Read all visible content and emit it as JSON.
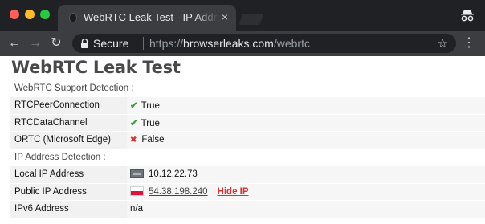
{
  "browser": {
    "tab_title": "WebRTC Leak Test - IP Address",
    "tab_close": "×",
    "secure_label": "Secure",
    "url_scheme": "https://",
    "url_host": "browserleaks.com",
    "url_path": "/webrtc",
    "icons": {
      "back": "arrow-left-icon",
      "forward": "arrow-right-icon",
      "reload": "reload-icon",
      "star": "star-icon",
      "menu": "kebab-menu-icon",
      "incognito": "incognito-icon"
    }
  },
  "page": {
    "title": "WebRTC Leak Test",
    "support_section": "WebRTC Support Detection :",
    "support_rows": [
      {
        "label": "RTCPeerConnection",
        "value": "True",
        "status": "ok"
      },
      {
        "label": "RTCDataChannel",
        "value": "True",
        "status": "ok"
      },
      {
        "label": "ORTC (Microsoft Edge)",
        "value": "False",
        "status": "no"
      }
    ],
    "ip_section": "IP Address Detection :",
    "ip_rows": {
      "local": {
        "label": "Local IP Address",
        "value": "10.12.22.73"
      },
      "public": {
        "label": "Public IP Address",
        "value": "54.38.198.240",
        "action": "Hide IP"
      },
      "ipv6": {
        "label": "IPv6 Address",
        "value": "n/a"
      }
    }
  },
  "colors": {
    "ok": "#3c9a36",
    "no": "#d23434",
    "chrome_dark": "#202124",
    "toolbar": "#3c3d41"
  }
}
